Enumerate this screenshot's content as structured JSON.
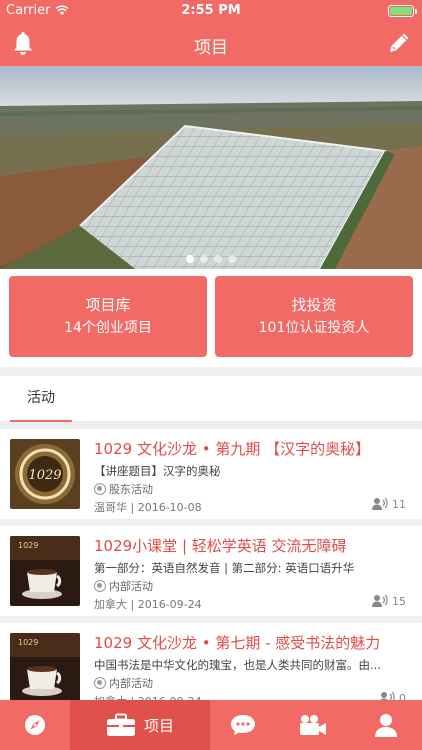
{
  "status_bar": {
    "carrier": "Carrier",
    "time": "2:55 PM"
  },
  "nav": {
    "title": "项目",
    "left_icon": "bell-icon",
    "right_icon": "pencil-icon"
  },
  "banner": {
    "slides": 4,
    "active_slide": 1
  },
  "quick_actions": [
    {
      "title": "项目库",
      "subtitle": "14个创业项目"
    },
    {
      "title": "找投资",
      "subtitle": "101位认证投资人"
    }
  ],
  "section": {
    "tab": "活动"
  },
  "activities": [
    {
      "title": "1029 文化沙龙 • 第九期 【汉字的奥秘】",
      "desc": "【讲座题目】汉字的奥秘",
      "tag": "股东活动",
      "author": "温哥华",
      "date": "2016-10-08",
      "count": "11",
      "thumb_text": "1029"
    },
    {
      "title": "1029小课堂 | 轻松学英语  交流无障碍",
      "desc": "第一部分：英语自然发音 |  第二部分: 英语口语升华",
      "tag": "内部活动",
      "author": "加拿大",
      "date": "2016-09-24",
      "count": "15",
      "thumb_text": "1029"
    },
    {
      "title": "1029 文化沙龙 • 第七期 - 感受书法的魅力",
      "desc": "中国书法是中华文化的瑰宝，也是人类共同的财富。由...",
      "tag": "内部活动",
      "author": "加拿大",
      "date": "2016-09-24",
      "count": "0",
      "thumb_text": "1029"
    }
  ],
  "tabbar": [
    {
      "icon": "compass-icon",
      "label": ""
    },
    {
      "icon": "briefcase-icon",
      "label": "项目",
      "active": true
    },
    {
      "icon": "chat-icon",
      "label": ""
    },
    {
      "icon": "video-camera-icon",
      "label": ""
    },
    {
      "icon": "user-icon",
      "label": ""
    }
  ],
  "colors": {
    "primary": "#f26a66",
    "active_tab": "#e0504c",
    "title_red": "#e14d4a"
  }
}
